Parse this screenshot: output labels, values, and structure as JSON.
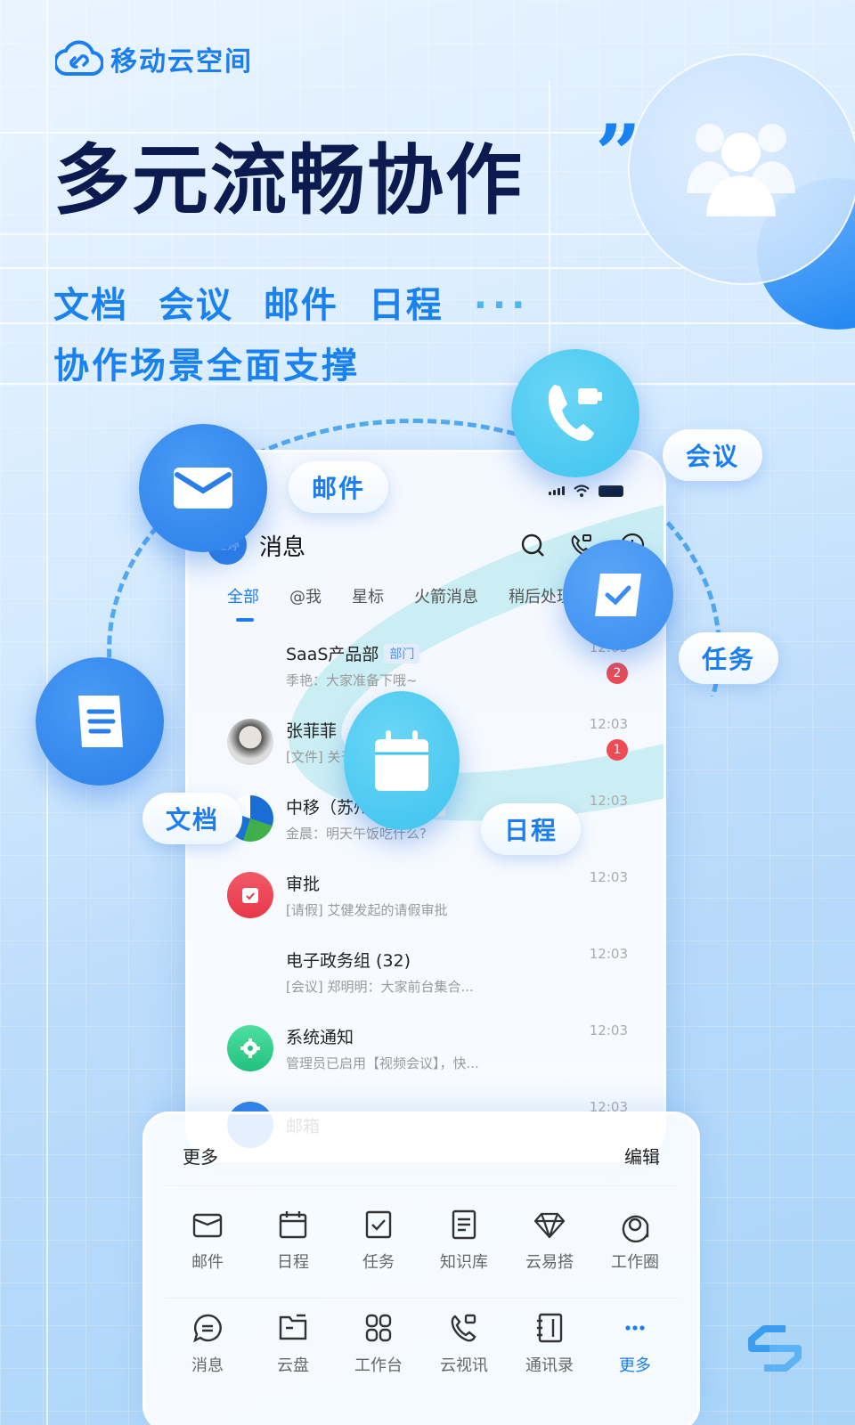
{
  "brand": {
    "name": "移动云空间",
    "logo_icon": "cloud-link-icon"
  },
  "hero": {
    "title": "多元流畅协作",
    "quote_mark": "”",
    "features_line": [
      "文档",
      "会议",
      "邮件",
      "日程"
    ],
    "features_more": "···",
    "tagline": "协作场景全面支撑"
  },
  "floating": {
    "mail": {
      "label": "邮件",
      "icon": "envelope-icon"
    },
    "meeting": {
      "label": "会议",
      "icon": "video-phone-icon"
    },
    "task": {
      "label": "任务",
      "icon": "check-icon"
    },
    "doc": {
      "label": "文档",
      "icon": "document-icon"
    },
    "schedule": {
      "label": "日程",
      "icon": "calendar-icon"
    },
    "people_icon": "people-group-icon"
  },
  "phone": {
    "avatar_text": "王婷",
    "title": "消息",
    "tabs": [
      "全部",
      "@我",
      "星标",
      "火箭消息",
      "稍后处理"
    ],
    "active_tab": 0,
    "conversations": [
      {
        "name": "SaaS产品部",
        "tag": "部门",
        "preview": "季艳：大家准备下哦~",
        "time": "12:03",
        "unread": "2",
        "avatar": "group-mosaic"
      },
      {
        "name": "张菲菲",
        "preview": "[文件] 关于…现状...",
        "time": "12:03",
        "unread": "1",
        "avatar": "person-photo"
      },
      {
        "name": "中移（苏州）…",
        "tag": "全员",
        "preview": "金晨：明天午饭吃什么?",
        "time": "12:03",
        "avatar": "china-mobile-logo"
      },
      {
        "name": "审批",
        "preview": "[请假] 艾健发起的请假审批",
        "time": "12:03",
        "avatar": "approval-icon",
        "color": "#f0495a"
      },
      {
        "name": "电子政务组 (32)",
        "preview": "[会议] 郑明明：大家前台集合...",
        "time": "12:03",
        "avatar": "group-mosaic"
      },
      {
        "name": "系统通知",
        "preview": "管理员已启用【视频会议】，快...",
        "time": "12:03",
        "avatar": "gear-icon",
        "color": "#2fcf8a"
      },
      {
        "name": "邮箱",
        "preview": "",
        "time": "12:03",
        "avatar": "mail-avatar",
        "color": "#2e7fe8"
      }
    ]
  },
  "more_panel": {
    "title": "更多",
    "edit": "编辑",
    "apps": [
      {
        "label": "邮件",
        "icon": "mail-icon"
      },
      {
        "label": "日程",
        "icon": "calendar-icon"
      },
      {
        "label": "任务",
        "icon": "task-check-icon"
      },
      {
        "label": "知识库",
        "icon": "knowledge-doc-icon"
      },
      {
        "label": "云易搭",
        "icon": "diamond-icon"
      },
      {
        "label": "工作圈",
        "icon": "work-circle-icon"
      }
    ],
    "bottom_nav": [
      {
        "label": "消息",
        "icon": "chat-icon"
      },
      {
        "label": "云盘",
        "icon": "folder-icon"
      },
      {
        "label": "工作台",
        "icon": "grid-icon"
      },
      {
        "label": "云视讯",
        "icon": "video-phone-icon"
      },
      {
        "label": "通讯录",
        "icon": "contacts-book-icon"
      },
      {
        "label": "更多",
        "icon": "more-dots-icon",
        "active": true
      }
    ]
  },
  "colors": {
    "accent": "#1a7df0",
    "title_dark": "#0b1a4f",
    "badge_red": "#ee4b55",
    "approval_red": "#f0495a",
    "system_green": "#2fcf8a",
    "disc_blue": "#2f86ec",
    "disc_cyan": "#4ccbf0"
  }
}
